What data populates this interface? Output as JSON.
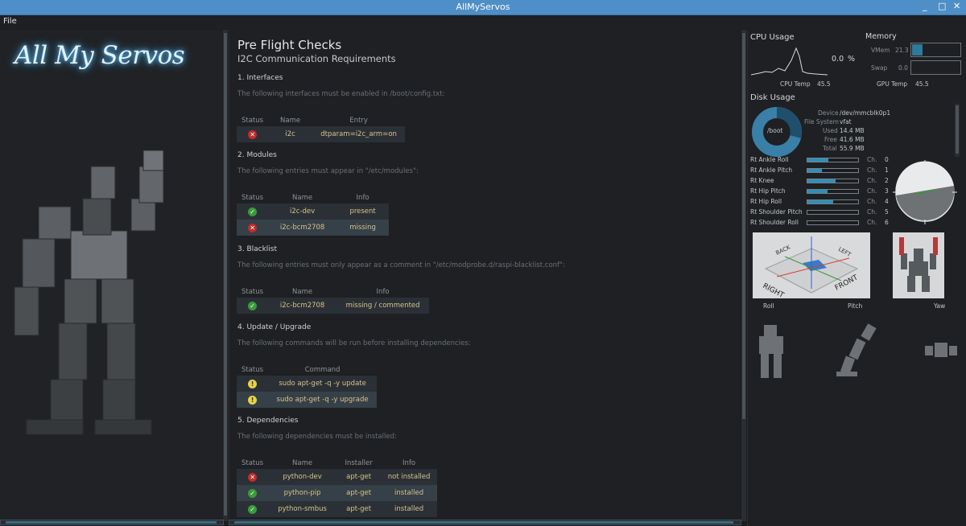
{
  "window": {
    "title": "AllMyServos"
  },
  "menu": {
    "file": "File"
  },
  "logo": {
    "text": "All My Servos"
  },
  "checks": {
    "title": "Pre Flight Checks",
    "subtitle": "I2C Communication Requirements",
    "interfaces": {
      "heading": "1. Interfaces",
      "desc": "The following interfaces must be enabled in /boot/config.txt:",
      "headers": [
        "Status",
        "Name",
        "Entry"
      ],
      "rows": [
        {
          "status": "error",
          "name": "i2c",
          "entry": "dtparam=i2c_arm=on"
        }
      ]
    },
    "modules": {
      "heading": "2. Modules",
      "desc": "The following entries must appear in \"/etc/modules\":",
      "headers": [
        "Status",
        "Name",
        "Info"
      ],
      "rows": [
        {
          "status": "ok",
          "name": "i2c-dev",
          "info": "present"
        },
        {
          "status": "error",
          "name": "i2c-bcm2708",
          "info": "missing"
        }
      ]
    },
    "blacklist": {
      "heading": "3. Blacklist",
      "desc": "The following entries must only appear as a comment in \"/etc/modprobe.d/raspi-blacklist.conf\":",
      "headers": [
        "Status",
        "Name",
        "Info"
      ],
      "rows": [
        {
          "status": "ok",
          "name": "i2c-bcm2708",
          "info": "missing / commented"
        }
      ]
    },
    "update": {
      "heading": "4. Update / Upgrade",
      "desc": "The following commands will be run before installing dependencies:",
      "headers": [
        "Status",
        "Command"
      ],
      "rows": [
        {
          "status": "pending",
          "command": "sudo apt-get -q -y update"
        },
        {
          "status": "pending",
          "command": "sudo apt-get -q -y upgrade"
        }
      ]
    },
    "dependencies": {
      "heading": "5. Dependencies",
      "desc": "The following dependencies must be installed:",
      "headers": [
        "Status",
        "Name",
        "Installer",
        "Info"
      ],
      "rows": [
        {
          "status": "error",
          "name": "python-dev",
          "installer": "apt-get",
          "info": "not installed"
        },
        {
          "status": "ok",
          "name": "python-pip",
          "installer": "apt-get",
          "info": "installed"
        },
        {
          "status": "ok",
          "name": "python-smbus",
          "installer": "apt-get",
          "info": "installed"
        }
      ]
    }
  },
  "status_colors": {
    "error": "#c32a2a",
    "ok": "#3a9b3a",
    "pending": "#e6d24a"
  },
  "cpu": {
    "title": "CPU Usage",
    "usage_value": "0.0",
    "usage_unit": "%",
    "temp_label": "CPU Temp",
    "temp_value": "45.5",
    "gpu_label": "GPU Temp",
    "gpu_value": "45.5"
  },
  "memory": {
    "title": "Memory",
    "vmem_label": "VMem",
    "vmem_value": "21.3",
    "vmem_fraction": 0.213,
    "swap_label": "Swap",
    "swap_value": "0.0",
    "swap_fraction": 0
  },
  "disk": {
    "title": "Disk Usage",
    "mount": "/boot",
    "device_label": "Device",
    "device_value": "/dev/mmcblk0p1",
    "fs_label": "File System",
    "fs_value": "vfat",
    "used_label": "Used",
    "used_value": "14.4 MB",
    "free_label": "Free",
    "free_value": "41.6 MB",
    "total_label": "Total",
    "total_value": "55.9 MB"
  },
  "servos": [
    {
      "name": "Rt Ankle Roll",
      "ch_label": "Ch.",
      "channel": "0",
      "level": 0.42
    },
    {
      "name": "Rt Ankle Pitch",
      "ch_label": "Ch.",
      "channel": "1",
      "level": 0.28
    },
    {
      "name": "Rt Knee",
      "ch_label": "Ch.",
      "channel": "2",
      "level": 0.55
    },
    {
      "name": "Rt Hip Pitch",
      "ch_label": "Ch.",
      "channel": "3",
      "level": 0.4
    },
    {
      "name": "Rt Hip Roll",
      "ch_label": "Ch.",
      "channel": "4",
      "level": 0.5
    },
    {
      "name": "Rt Shoulder Pitch",
      "ch_label": "Ch.",
      "channel": "5",
      "level": 0
    },
    {
      "name": "Rt Shoulder Roll",
      "ch_label": "Ch.",
      "channel": "6",
      "level": 0
    }
  ],
  "orientation": {
    "label_3d": [
      "BACK",
      "LEFT",
      "RIGHT",
      "FRONT"
    ],
    "roll": "Roll",
    "pitch": "Pitch",
    "yaw": "Yaw"
  }
}
